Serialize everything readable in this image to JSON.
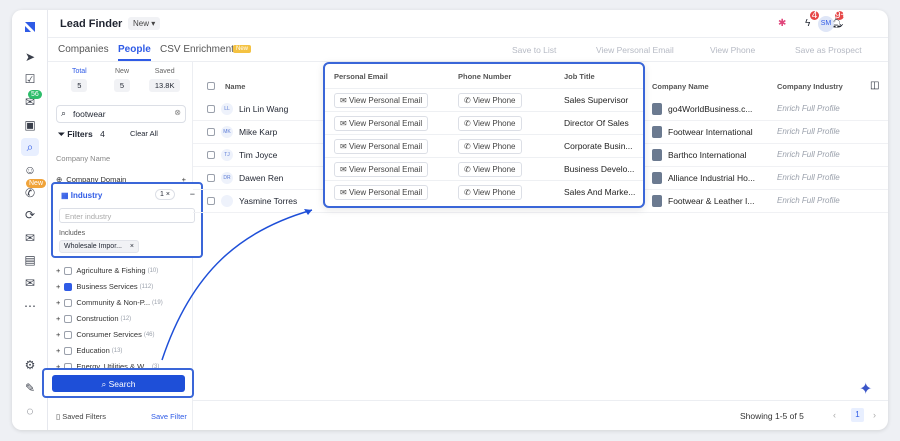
{
  "app": {
    "title": "Lead Finder",
    "version_chip": "New ▾"
  },
  "rail_badges": {
    "inbox": "56",
    "calls": "New"
  },
  "topbar": {
    "bolt_badge": "4",
    "bell_badge": "9+",
    "avatar": "SM"
  },
  "tabs": [
    {
      "label": "Companies"
    },
    {
      "label": "People"
    },
    {
      "label": "CSV Enrichment"
    }
  ],
  "csv_badge": "New",
  "toolbar": {
    "save_to_list": "Save to List",
    "view_email": "View Personal Email",
    "view_phone": "View Phone",
    "save_prospect": "Save as Prospect"
  },
  "stats": [
    {
      "label": "Total",
      "value": "5"
    },
    {
      "label": "New",
      "value": "5"
    },
    {
      "label": "Saved",
      "value": "13.8K"
    }
  ],
  "search": {
    "value": "footwear"
  },
  "filters": {
    "label": "Filters",
    "count": "4",
    "clear_all": "Clear All",
    "company_name": "Company Name",
    "company_domain": "Company Domain"
  },
  "industry": {
    "label": "Industry",
    "count": "1 ×",
    "placeholder": "Enter industry",
    "includes_label": "Includes",
    "selected": "Wholesale Impor..."
  },
  "industry_list": [
    {
      "label": "Agriculture & Fishing",
      "count": "(10)",
      "checked": false
    },
    {
      "label": "Business Services",
      "count": "(112)",
      "checked": true
    },
    {
      "label": "Community & Non-P...",
      "count": "(19)",
      "checked": false
    },
    {
      "label": "Construction",
      "count": "(12)",
      "checked": false
    },
    {
      "label": "Consumer Services",
      "count": "(46)",
      "checked": false
    },
    {
      "label": "Education",
      "count": "(13)",
      "checked": false
    },
    {
      "label": "Energy, Utilities & W...",
      "count": "(3)",
      "checked": false
    }
  ],
  "search_button": "Search",
  "saved_filters": {
    "label": "Saved Filters",
    "action": "Save Filter"
  },
  "table": {
    "headers": {
      "name": "Name",
      "email": "Personal Email",
      "phone": "Phone Number",
      "title": "Job Title",
      "company": "Company Name",
      "industry": "Company Industry"
    },
    "rows": [
      {
        "initials": "LL",
        "name": "Lin Lin Wang",
        "title": "Sales Supervisor",
        "company": "go4WorldBusiness.c...",
        "industry": "Enrich Full Profile"
      },
      {
        "initials": "MK",
        "name": "Mike Karp",
        "title": "Director Of Sales",
        "company": "Footwear International",
        "industry": "Enrich Full Profile"
      },
      {
        "initials": "TJ",
        "name": "Tim Joyce",
        "title": "Corporate Busin...",
        "company": "Barthco International",
        "industry": "Enrich Full Profile"
      },
      {
        "initials": "DR",
        "name": "Dawen Ren",
        "title": "Business Develo...",
        "company": "Alliance Industrial Ho...",
        "industry": "Enrich Full Profile"
      },
      {
        "initials": "",
        "name": "Yasmine Torres",
        "title": "Sales And Marke...",
        "company": "Footwear & Leather I...",
        "industry": "Enrich Full Profile"
      }
    ],
    "view_email": "View Personal Email",
    "view_phone": "View Phone"
  },
  "footer": {
    "showing": "Showing  1-5 of 5",
    "page": "1"
  },
  "colors": {
    "accent": "#2f5be6",
    "highlight_border": "#3a66d8"
  }
}
